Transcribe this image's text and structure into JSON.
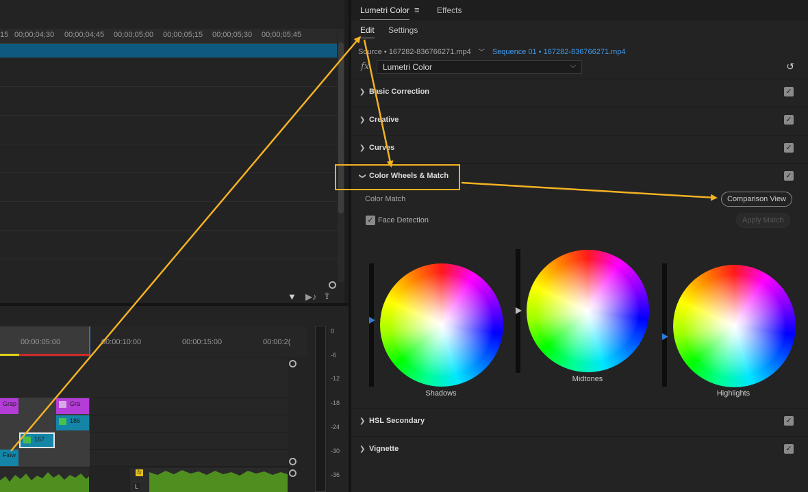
{
  "left_top": {
    "timecodes": [
      "15",
      "00;00;04;30",
      "00;00;04;45",
      "00;00;05;00",
      "00;00;05;15",
      "00;00;05;30",
      "00;00;05;45"
    ]
  },
  "timeline": {
    "timecodes": [
      "00:00:05:00",
      "00:00:10:00",
      "00:00:15:00",
      "00:00:2("
    ],
    "clips": {
      "graph1": "Grap",
      "graph2": "Gra",
      "clip186": "186",
      "clip167": "167",
      "fiow": "Fiow"
    },
    "audio_marker": "L"
  },
  "meter": {
    "labels": [
      "0",
      "-6",
      "-12",
      "-18",
      "-24",
      "-30",
      "-36"
    ]
  },
  "lumetri": {
    "tab_active": "Lumetri Color",
    "tab_other": "Effects",
    "subtab_edit": "Edit",
    "subtab_settings": "Settings",
    "source": "Source • 167282-836766271.mp4",
    "sequence": "Sequence 01 • 167282-836766271.mp4",
    "fx_symbol": "fx",
    "effect_select": "Lumetri Color",
    "sections": {
      "basic": "Basic Correction",
      "creative": "Creative",
      "curves": "Curves",
      "color_wheels": "Color Wheels & Match",
      "hsl": "HSL Secondary",
      "vignette": "Vignette"
    },
    "color_match_label": "Color Match",
    "comparison_view": "Comparison View",
    "face_detection": "Face Detection",
    "apply_match": "Apply Match",
    "wheels": {
      "shadows": "Shadows",
      "midtones": "Midtones",
      "highlights": "Highlights"
    }
  },
  "colors": {
    "annotation": "#f4b223",
    "link_blue": "#3f9bf0",
    "clip_purple": "#b43cd7",
    "clip_teal": "#1485a6",
    "audio_green": "#4f8f1f"
  }
}
